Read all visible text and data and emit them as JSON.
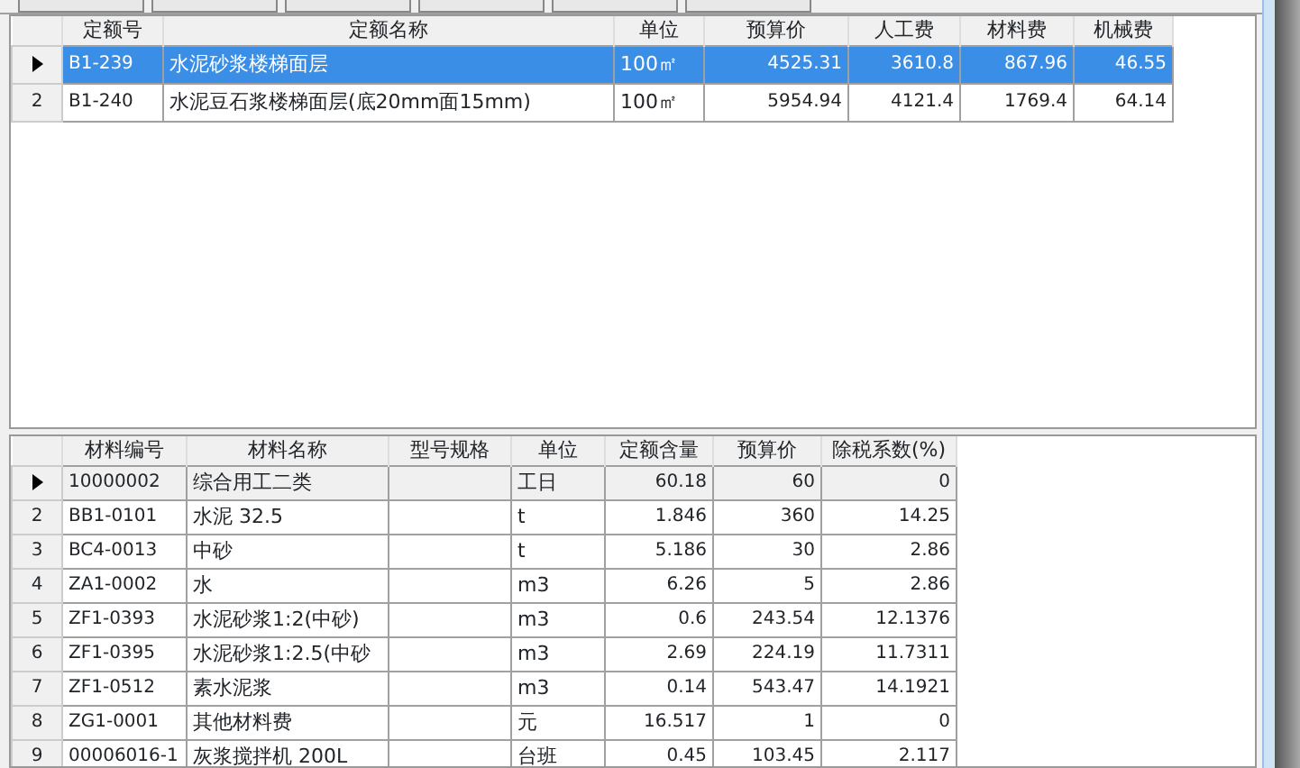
{
  "quota_grid": {
    "columns": [
      "定额号",
      "定额名称",
      "单位",
      "预算价",
      "人工费",
      "材料费",
      "机械费"
    ],
    "rows": [
      {
        "number": "",
        "selected": true,
        "cells": [
          "B1-239",
          "水泥砂浆楼梯面层",
          "100㎡",
          "4525.31",
          "3610.8",
          "867.96",
          "46.55"
        ]
      },
      {
        "number": "2",
        "selected": false,
        "cells": [
          "B1-240",
          "水泥豆石浆楼梯面层(底20mm面15mm)",
          "100㎡",
          "5954.94",
          "4121.4",
          "1769.4",
          "64.14"
        ]
      }
    ]
  },
  "material_grid": {
    "columns": [
      "材料编号",
      "材料名称",
      "型号规格",
      "单位",
      "定额含量",
      "预算价",
      "除税系数(%)"
    ],
    "rows": [
      {
        "number": "",
        "selected": true,
        "cells": [
          "10000002",
          "综合用工二类",
          "",
          "工日",
          "60.18",
          "60",
          "0"
        ]
      },
      {
        "number": "2",
        "selected": false,
        "cells": [
          "BB1-0101",
          "水泥 32.5",
          "",
          "t",
          "1.846",
          "360",
          "14.25"
        ]
      },
      {
        "number": "3",
        "selected": false,
        "cells": [
          "BC4-0013",
          "中砂",
          "",
          "t",
          "5.186",
          "30",
          "2.86"
        ]
      },
      {
        "number": "4",
        "selected": false,
        "cells": [
          "ZA1-0002",
          "水",
          "",
          "m3",
          "6.26",
          "5",
          "2.86"
        ]
      },
      {
        "number": "5",
        "selected": false,
        "cells": [
          "ZF1-0393",
          "水泥砂浆1:2(中砂)",
          "",
          "m3",
          "0.6",
          "243.54",
          "12.1376"
        ]
      },
      {
        "number": "6",
        "selected": false,
        "cells": [
          "ZF1-0395",
          "水泥砂浆1:2.5(中砂",
          "",
          "m3",
          "2.69",
          "224.19",
          "11.7311"
        ]
      },
      {
        "number": "7",
        "selected": false,
        "cells": [
          "ZF1-0512",
          "素水泥浆",
          "",
          "m3",
          "0.14",
          "543.47",
          "14.1921"
        ]
      },
      {
        "number": "8",
        "selected": false,
        "cells": [
          "ZG1-0001",
          "其他材料费",
          "",
          "元",
          "16.517",
          "1",
          "0"
        ]
      },
      {
        "number": "9",
        "selected": false,
        "cells": [
          "00006016-1",
          "灰浆搅拌机 200L",
          "",
          "台班",
          "0.45",
          "103.45",
          "2.117"
        ]
      }
    ]
  }
}
